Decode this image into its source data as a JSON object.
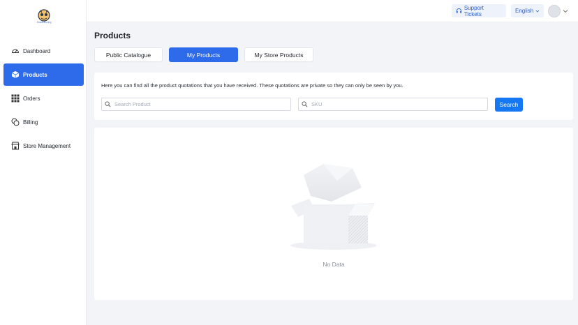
{
  "brand": {
    "logo_caption": "ShadeBoxing"
  },
  "sidebar": {
    "items": [
      {
        "label": "Dashboard",
        "icon": "dashboard-gauge-icon",
        "active": false
      },
      {
        "label": "Products",
        "icon": "box-icon",
        "active": true
      },
      {
        "label": "Orders",
        "icon": "grid-icon",
        "active": false
      },
      {
        "label": "Billing",
        "icon": "coins-icon",
        "active": false
      },
      {
        "label": "Store Management",
        "icon": "store-icon",
        "active": false
      }
    ]
  },
  "topbar": {
    "support_label": "Support Tickets",
    "support_icon": "headset-icon",
    "language_label": "English",
    "avatar_icon": "avatar-icon"
  },
  "page": {
    "title": "Products",
    "tabs": [
      {
        "label": "Public Catalogue",
        "active": false
      },
      {
        "label": "My Products",
        "active": true
      },
      {
        "label": "My Store Products",
        "active": false
      }
    ]
  },
  "search": {
    "description": "Here you can find all the product quotations that you have received. These quotations are private so they can only be seen by you.",
    "product_placeholder": "Search Product",
    "product_value": "",
    "sku_placeholder": "SKU",
    "sku_value": "",
    "button_label": "Search"
  },
  "results": {
    "empty_text": "No Data",
    "empty_icon": "empty-box-icon"
  },
  "colors": {
    "accent": "#2d6bea",
    "search_button": "#1677f2",
    "background": "#f3f4f8"
  }
}
